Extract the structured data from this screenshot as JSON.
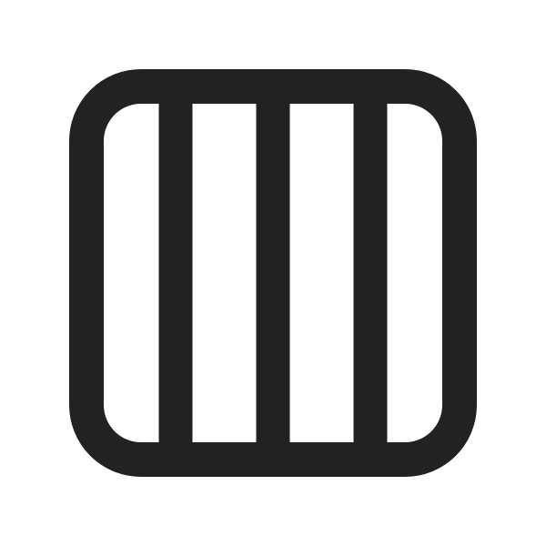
{
  "icon": {
    "name": "column-grid-icon",
    "column_count": 4,
    "stroke_color": "#222222",
    "background_color": "#ffffff"
  }
}
